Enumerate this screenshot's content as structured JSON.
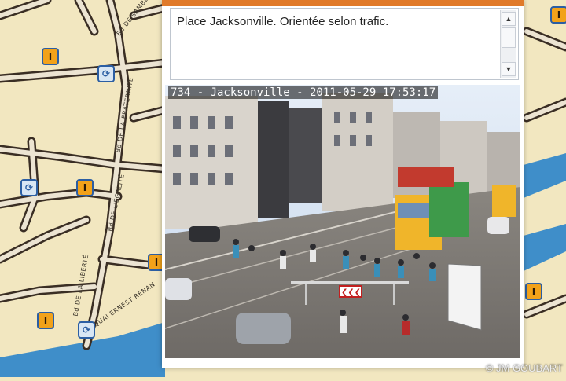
{
  "map": {
    "streets": [
      "Bd DE SAMBLANCAY",
      "Bd DE LA FRATERNITÉ",
      "Bd DE L'ÉGALITÉ",
      "Bd DE LA LIBERTÉ",
      "QUAI ERNEST RENAN"
    ],
    "info_marker_glyph": "I",
    "camera_marker_glyph": "⟳"
  },
  "popup": {
    "description": "Place Jacksonville. Orientée selon trafic.",
    "scroll_up": "▲",
    "scroll_down": "▼"
  },
  "camera": {
    "caption": "734 - Jacksonville - 2011-05-29 17:53:17",
    "barrier_sign": "❮❮❮"
  },
  "watermark": "© JM GOUBART",
  "colors": {
    "map_bg": "#f2e7c0",
    "road_casing": "#3a2e24",
    "road_fill": "#ece4d2",
    "river": "#3f8ec9",
    "popup_accent": "#e07a2a"
  }
}
